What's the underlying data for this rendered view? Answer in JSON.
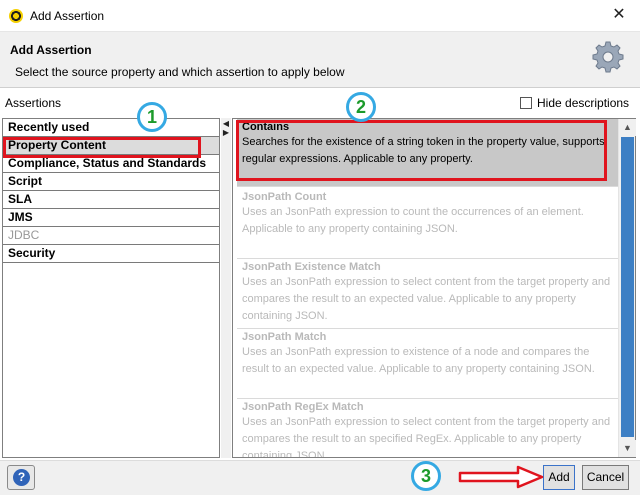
{
  "window": {
    "title": "Add Assertion",
    "close_glyph": "✕",
    "icon": "soapui-icon"
  },
  "header": {
    "title": "Add Assertion",
    "description": "Select the source property and which assertion to apply below",
    "icon": "gear-icon"
  },
  "labels": {
    "assertions": "Assertions",
    "hide_descriptions": "Hide descriptions"
  },
  "categories": [
    {
      "label": "Recently used",
      "enabled": true,
      "selected": false
    },
    {
      "label": "Property Content",
      "enabled": true,
      "selected": true
    },
    {
      "label": "Compliance, Status and Standards",
      "enabled": true,
      "selected": false
    },
    {
      "label": "Script",
      "enabled": true,
      "selected": false
    },
    {
      "label": "SLA",
      "enabled": true,
      "selected": false
    },
    {
      "label": "JMS",
      "enabled": true,
      "selected": false
    },
    {
      "label": "JDBC",
      "enabled": false,
      "selected": false
    },
    {
      "label": "Security",
      "enabled": true,
      "selected": false
    }
  ],
  "assertions": [
    {
      "name": "Contains",
      "description": "Searches for the existence of a string token in the property value, supports regular expressions. Applicable to any property.",
      "enabled": true,
      "selected": true
    },
    {
      "name": "JsonPath Count",
      "description": "Uses an JsonPath expression to count the occurrences of an element. Applicable to any property containing JSON.",
      "enabled": false,
      "selected": false
    },
    {
      "name": "JsonPath Existence Match",
      "description": "Uses an JsonPath expression to select content from the target property and compares the result to an expected value. Applicable to any property containing JSON.",
      "enabled": false,
      "selected": false
    },
    {
      "name": "JsonPath Match",
      "description": "Uses an JsonPath expression to existence of a node and compares the result to an expected value. Applicable to any property containing JSON.",
      "enabled": false,
      "selected": false
    },
    {
      "name": "JsonPath RegEx Match",
      "description": "Uses an JsonPath expression to select content from the target property and compares the result to an specified RegEx. Applicable to any property containing JSON.",
      "enabled": false,
      "selected": false
    }
  ],
  "buttons": {
    "help": "?",
    "add": "Add",
    "cancel": "Cancel"
  },
  "annotations": {
    "badge1": "1",
    "badge2": "2",
    "badge3": "3",
    "highlight_color": "#e0141e",
    "badge_ring_color": "#35a9e3",
    "badge_text_color": "#1b9a2a"
  },
  "colors": {
    "scroll_thumb": "#3d7fc4",
    "selected_row": "#c8c8c8"
  }
}
